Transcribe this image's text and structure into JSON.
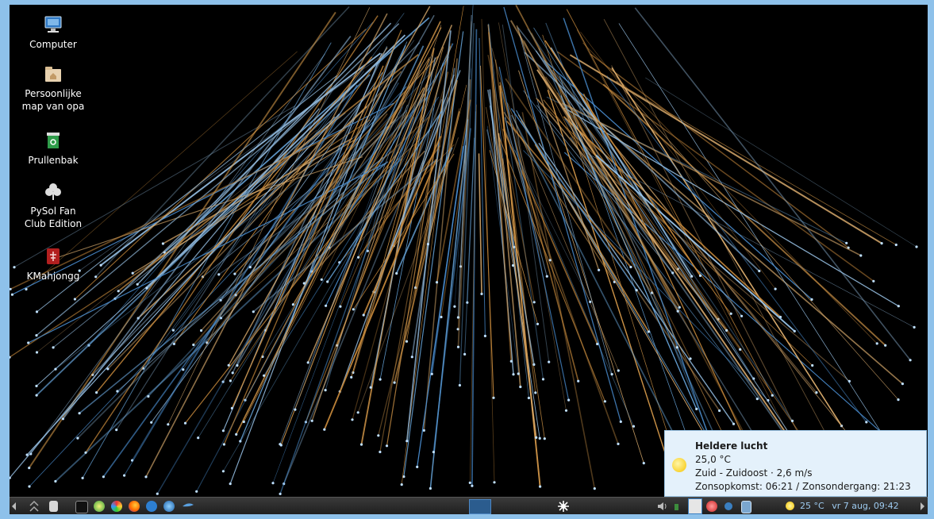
{
  "desktop": {
    "icons": [
      {
        "label": "Computer",
        "icon": "computer-icon"
      },
      {
        "label": "Persoonlijke map van opa",
        "icon": "home-folder-icon"
      },
      {
        "label": "Prullenbak",
        "icon": "trash-icon"
      },
      {
        "label": "PySol Fan Club Edition",
        "icon": "cards-icon"
      },
      {
        "label": "KMahjongg",
        "icon": "mahjongg-icon"
      }
    ]
  },
  "weather_popup": {
    "title": "Heldere lucht",
    "temperature": "25,0 °C",
    "wind": "Zuid - Zuidoost · 2,6 m/s",
    "sun": "Zonsopkomst: 06:21 / Zonsondergang: 21:23"
  },
  "taskbar": {
    "weather": "25 °C",
    "clock": "vr  7 aug, 09:42",
    "colors": {
      "accent": "#3a7fc1",
      "clock_text": "#9ecbf0"
    }
  }
}
